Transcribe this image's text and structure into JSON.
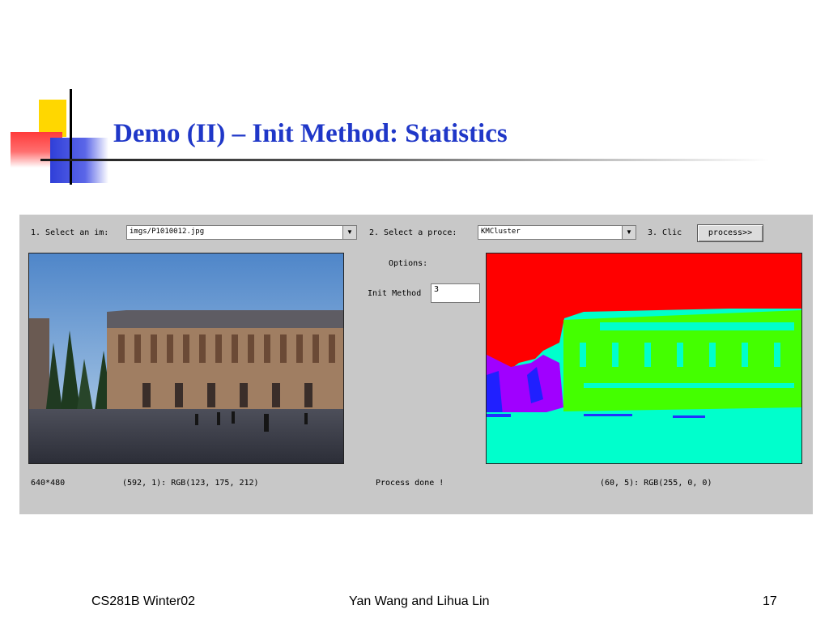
{
  "slide": {
    "title": "Demo (II) – Init Method: Statistics",
    "footer_left": "CS281B Winter02",
    "footer_center": "Yan Wang and Lihua Lin",
    "footer_right": "17"
  },
  "app": {
    "step1_label": "1. Select an im:",
    "image_select_value": "imgs/P1010012.jpg",
    "step2_label": "2. Select a proce:",
    "process_select_value": "KMCluster",
    "step3_label": "3. Clic",
    "process_button_label": "process>>",
    "options_label": "Options:",
    "init_method_label": "Init Method",
    "init_method_value": "3",
    "image_dimensions": "640*480",
    "left_pixel_info": "(592, 1):  RGB(123, 175, 212)",
    "status_text": "Process done !",
    "right_pixel_info": "(60, 5):  RGB(255, 0, 0)"
  },
  "colors": {
    "title": "#1f37c8",
    "app_bg": "#c8c8c8",
    "cluster_red": "#ff0000",
    "cluster_cyan": "#00ffcc",
    "cluster_green": "#44ff00",
    "cluster_purple": "#a000ff",
    "cluster_blue": "#2020ff"
  }
}
